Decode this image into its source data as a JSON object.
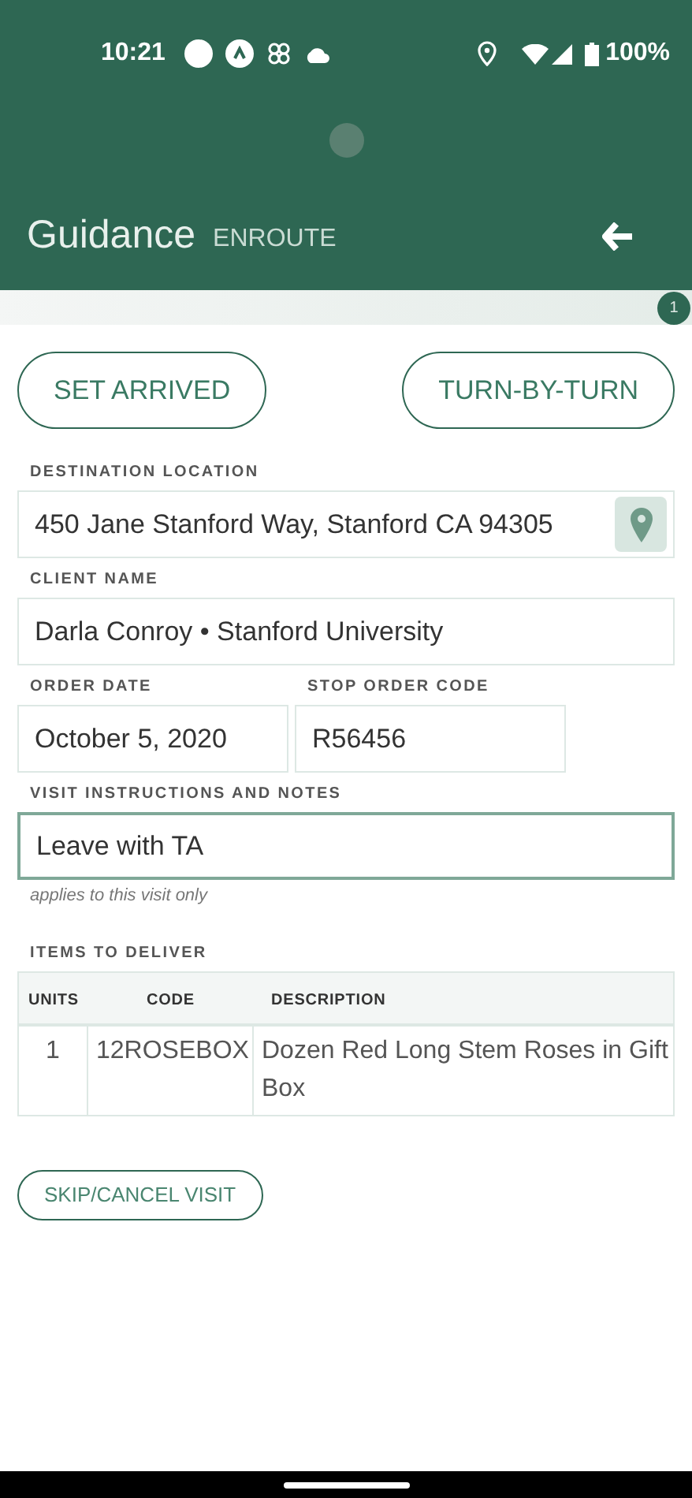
{
  "status_bar": {
    "time": "10:21",
    "battery": "100%"
  },
  "header": {
    "title": "Guidance",
    "status": "ENROUTE"
  },
  "step_badge": "1",
  "actions": [
    "SET ARRIVED",
    "TURN-BY-TURN"
  ],
  "fields": [
    {
      "kind": "location",
      "label": "DESTINATION LOCATION",
      "value": "450 Jane Stanford Way, Stanford CA 94305",
      "focused": false
    },
    {
      "kind": "full",
      "label": "CLIENT NAME",
      "value": "Darla Conroy • Stanford University",
      "focused": false
    },
    {
      "kind": "half",
      "label": "ORDER DATE",
      "value": "October 5, 2020",
      "focused": false
    },
    {
      "kind": "half",
      "label": "STOP ORDER CODE",
      "value": "R56456",
      "focused": false
    },
    {
      "kind": "full",
      "label": "VISIT INSTRUCTIONS AND NOTES",
      "value": "Leave with TA",
      "focused": true,
      "hint": "applies to this visit only"
    }
  ],
  "items": {
    "title": "ITEMS TO DELIVER",
    "columns": [
      "UNITS",
      "CODE",
      "DESCRIPTION"
    ],
    "rows": [
      [
        "1",
        "12ROSEBOX",
        "Dozen Red Long Stem Roses in Gift Box"
      ]
    ]
  },
  "skip_button": "SKIP/CANCEL VISIT"
}
